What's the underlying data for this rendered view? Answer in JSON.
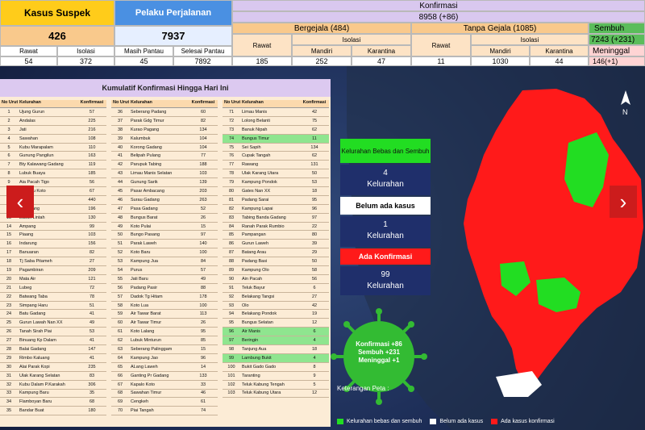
{
  "header": {
    "suspek": {
      "title": "Kasus Suspek",
      "total": "426",
      "rawat_label": "Rawat",
      "rawat": "54",
      "isolasi_label": "Isolasi",
      "isolasi": "372"
    },
    "pelaku": {
      "title": "Pelaku Perjalanan",
      "total": "7937",
      "pantau_label": "Masih Pantau",
      "pantau": "45",
      "selesai_label": "Selesai Pantau",
      "selesai": "7892"
    },
    "konfirmasi": {
      "title": "Konfirmasi",
      "total": "8958 (+86)"
    },
    "bergejala": {
      "title": "Bergejala (484)",
      "rawat_label": "Rawat",
      "rawat": "185",
      "isolasi_label": "Isolasi",
      "mandiri_label": "Mandiri",
      "mandiri": "252",
      "karantina_label": "Karantina",
      "karantina": "47"
    },
    "tanpa": {
      "title": "Tanpa Gejala (1085)",
      "rawat_label": "Rawat",
      "rawat": "11",
      "isolasi_label": "Isolasi",
      "mandiri_label": "Mandiri",
      "mandiri": "1030",
      "karantina_label": "Karantina",
      "karantina": "44"
    },
    "sembuh": {
      "title": "Sembuh",
      "total": "7243 (+231)",
      "meninggal_label": "Meninggal",
      "meninggal": "146(+1)"
    }
  },
  "table": {
    "title": "Kumulatif Konfirmasi Hingga Hari Ini",
    "col_no": "No Urut",
    "col_kel": "Kelurahan",
    "col_kon": "Konfirmasi",
    "columns": [
      [
        [
          "1",
          "Ujung Gurun",
          "57"
        ],
        [
          "2",
          "Andalas",
          "225"
        ],
        [
          "3",
          "Jati",
          "216"
        ],
        [
          "4",
          "Sawahan",
          "108"
        ],
        [
          "5",
          "Kubu Marapalam",
          "110"
        ],
        [
          "6",
          "Gunung Pangilun",
          "163"
        ],
        [
          "7",
          "Bty Kalawang Gadang",
          "119"
        ],
        [
          "8",
          "Lubuk Buaya",
          "185"
        ],
        [
          "9",
          "Aia Pacah Tigo",
          "56"
        ],
        [
          "10",
          "Pg Baru Koto",
          "67"
        ],
        [
          "11",
          "Pasar",
          "440"
        ],
        [
          "12",
          "Tangkiang",
          "196"
        ],
        [
          "13",
          "Lubuk Lintah",
          "130"
        ],
        [
          "14",
          "Ampang",
          "99"
        ],
        [
          "15",
          "Piaang",
          "103"
        ],
        [
          "16",
          "Indarung",
          "156"
        ],
        [
          "17",
          "Banuaran",
          "82"
        ],
        [
          "18",
          "Tj Saba Pitameh",
          "27"
        ],
        [
          "19",
          "Pagambiran",
          "209"
        ],
        [
          "20",
          "Mata Air",
          "121"
        ],
        [
          "21",
          "Lubeg",
          "72"
        ],
        [
          "22",
          "Batwang Taba",
          "78"
        ],
        [
          "23",
          "Simpang Haru",
          "51"
        ],
        [
          "24",
          "Batu Gadang",
          "41"
        ],
        [
          "25",
          "Gurun Lawah Nan XX",
          "49"
        ],
        [
          "26",
          "Tanah Sirah Piai",
          "53"
        ],
        [
          "27",
          "Binuang Kp Dalam",
          "41"
        ],
        [
          "28",
          "Balai Gadang",
          "147"
        ],
        [
          "29",
          "Rimbo Kaluang",
          "41"
        ],
        [
          "30",
          "Alai Parak Kopi",
          "235"
        ],
        [
          "31",
          "Ulak Karang Selatan",
          "83"
        ],
        [
          "32",
          "Kubu Dalam P.Karakah",
          "306"
        ],
        [
          "33",
          "Kampung Baru",
          "35"
        ],
        [
          "34",
          "Flamboyan Baru",
          "68"
        ],
        [
          "35",
          "Bandar Buat",
          "180"
        ]
      ],
      [
        [
          "36",
          "Seberang Padang",
          "60"
        ],
        [
          "37",
          "Parak Gdg Timur",
          "82"
        ],
        [
          "38",
          "Kurao Pagang",
          "134"
        ],
        [
          "39",
          "Kalumbuk",
          "104"
        ],
        [
          "40",
          "Korong Gadang",
          "104"
        ],
        [
          "41",
          "Belipah Pulang",
          "77"
        ],
        [
          "42",
          "Parupuk Tabing",
          "188"
        ],
        [
          "43",
          "Limau Manis Selatan",
          "103"
        ],
        [
          "44",
          "Gunung Sarik",
          "139"
        ],
        [
          "45",
          "Pasar Ambacang",
          "203"
        ],
        [
          "46",
          "Surau Gadang",
          "263"
        ],
        [
          "47",
          "Pasa Gadang",
          "52"
        ],
        [
          "48",
          "Bungus Barat",
          "26"
        ],
        [
          "49",
          "Koto Pulai",
          "15"
        ],
        [
          "50",
          "Bungo Pasang",
          "97"
        ],
        [
          "51",
          "Parak Laweh",
          "140"
        ],
        [
          "52",
          "Koto Baru",
          "100"
        ],
        [
          "53",
          "Kampung Jua",
          "84"
        ],
        [
          "54",
          "Purus",
          "57"
        ],
        [
          "55",
          "Jati Baru",
          "49"
        ],
        [
          "56",
          "Padang Pasir",
          "88"
        ],
        [
          "57",
          "Dadok Tg Hitam",
          "178"
        ],
        [
          "58",
          "Koto Lua",
          "100"
        ],
        [
          "59",
          "Air Tawar Barat",
          "113"
        ],
        [
          "60",
          "Air Tawar Timur",
          "26"
        ],
        [
          "61",
          "Koto Lalang",
          "95"
        ],
        [
          "62",
          "Lubuk Minturun",
          "85"
        ],
        [
          "63",
          "Seberang Palinggam",
          "15"
        ],
        [
          "64",
          "Kampung Jao",
          "96"
        ],
        [
          "65",
          "ALang Laweh",
          "14"
        ],
        [
          "66",
          "Ganting Pr Gadang",
          "133"
        ],
        [
          "67",
          "Kapalo Koto",
          "33"
        ],
        [
          "68",
          "Sawahan Timur",
          "46"
        ],
        [
          "69",
          "Cengkeh",
          "61"
        ],
        [
          "70",
          "Piai Tangah",
          "74"
        ]
      ],
      [
        [
          "71",
          "Limau Manis",
          "42"
        ],
        [
          "72",
          "Lolong Belanti",
          "75"
        ],
        [
          "73",
          "Banuk Nipah",
          "62"
        ],
        [
          "74",
          "Bungus Timur",
          "11"
        ],
        [
          "75",
          "Sei Sapih",
          "134"
        ],
        [
          "76",
          "Cupak Tangah",
          "62"
        ],
        [
          "77",
          "Rawang",
          "131"
        ],
        [
          "78",
          "Ulak Karang Utara",
          "50"
        ],
        [
          "79",
          "Kampung Pondok",
          "53"
        ],
        [
          "80",
          "Gates Nan XX",
          "18"
        ],
        [
          "81",
          "Padang Sarai",
          "95"
        ],
        [
          "82",
          "Kampung Lapai",
          "96"
        ],
        [
          "83",
          "Tabing Banda Gadang",
          "97"
        ],
        [
          "84",
          "Ranah Parak Rumbio",
          "22"
        ],
        [
          "85",
          "Pampangan",
          "80"
        ],
        [
          "86",
          "Gurun Laweh",
          "39"
        ],
        [
          "87",
          "Batang Arau",
          "29"
        ],
        [
          "88",
          "Padang Basi",
          "50"
        ],
        [
          "89",
          "Kampung Olo",
          "58"
        ],
        [
          "90",
          "Ain Pacah",
          "56"
        ],
        [
          "91",
          "Teluk Bayur",
          "6"
        ],
        [
          "92",
          "Belakang Tangsi",
          "27"
        ],
        [
          "93",
          "Olo",
          "42"
        ],
        [
          "94",
          "Belakang Pondok",
          "19"
        ],
        [
          "95",
          "Bungus Selatan",
          "12"
        ],
        [
          "96",
          "Air Manis",
          "6"
        ],
        [
          "97",
          "Beringin",
          "4"
        ],
        [
          "98",
          "Tanjung Aua",
          "18"
        ],
        [
          "99",
          "Lambung Bukit",
          "4"
        ],
        [
          "100",
          "Bukit Gado Gado",
          "8"
        ],
        [
          "101",
          "Taranting",
          "9"
        ],
        [
          "102",
          "Teluk Kabung Tengah",
          "5"
        ],
        [
          "103",
          "Teluk Kabung Utara",
          "12"
        ]
      ]
    ],
    "green_rows": [
      "Bungus Timur",
      "Air Manis",
      "Beringin",
      "Lambung Bukit"
    ]
  },
  "legend": {
    "bebas_title": "Kelurahan Bebas dan Sembuh",
    "bebas_count": "4",
    "bebas_unit": "Kelurahan",
    "belum_title": "Belum ada kasus",
    "belum_count": "1",
    "belum_unit": "Kelurahan",
    "ada_title": "Ada Konfirmasi",
    "ada_count": "99",
    "ada_unit": "Kelurahan"
  },
  "virus": {
    "line1": "Konfirmasi +86",
    "line2": "Sembuh +231",
    "line3": "Meninggal +1"
  },
  "map_legend": {
    "title": "Keterangan Peta :",
    "green": "Kelurahan bebas dan sembuh",
    "white": "Belum ada kasus",
    "red": "Ada kasus konfirmasi"
  },
  "colors": {
    "green": "#22dd22",
    "red": "#ff1a1a",
    "white": "#ffffff",
    "nav": "#cc1c1c"
  },
  "icons": {
    "prev": "chevron-left-icon",
    "next": "chevron-right-icon",
    "north": "north-arrow-icon"
  }
}
